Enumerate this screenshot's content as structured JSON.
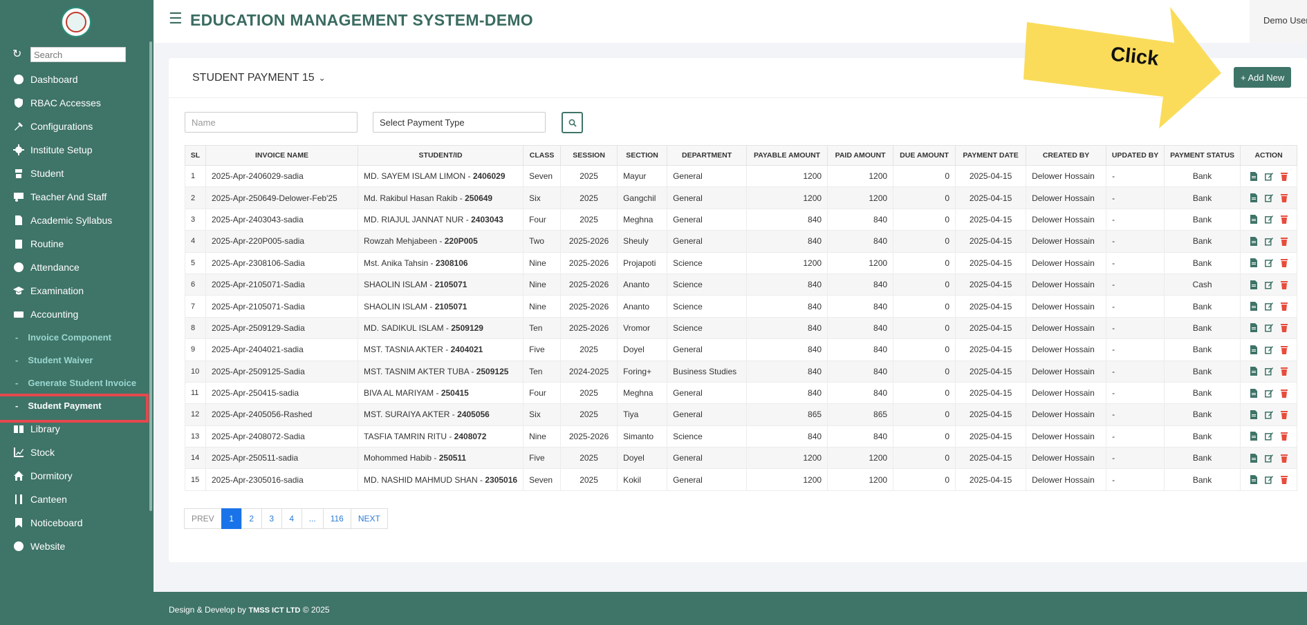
{
  "sidebar": {
    "search_placeholder": "Search",
    "items": [
      {
        "label": "Dashboard",
        "icon": "dashboard-icon"
      },
      {
        "label": "RBAC Accesses",
        "icon": "shield-icon"
      },
      {
        "label": "Configurations",
        "icon": "tools-icon"
      },
      {
        "label": "Institute Setup",
        "icon": "gear-icon"
      },
      {
        "label": "Student",
        "icon": "student-icon"
      },
      {
        "label": "Teacher And Staff",
        "icon": "teacher-icon"
      },
      {
        "label": "Academic Syllabus",
        "icon": "document-icon"
      },
      {
        "label": "Routine",
        "icon": "clipboard-icon"
      },
      {
        "label": "Attendance",
        "icon": "check-circle-icon"
      },
      {
        "label": "Examination",
        "icon": "graduation-cap-icon"
      },
      {
        "label": "Accounting",
        "icon": "money-icon"
      }
    ],
    "subitems": [
      {
        "label": "Invoice Component"
      },
      {
        "label": "Student Waiver"
      },
      {
        "label": "Generate Student Invoice"
      },
      {
        "label": "Student Payment"
      }
    ],
    "items2": [
      {
        "label": "Library",
        "icon": "book-icon"
      },
      {
        "label": "Stock",
        "icon": "chart-icon"
      },
      {
        "label": "Dormitory",
        "icon": "home-icon"
      },
      {
        "label": "Canteen",
        "icon": "utensils-icon"
      },
      {
        "label": "Noticeboard",
        "icon": "bookmark-icon"
      },
      {
        "label": "Website",
        "icon": "globe-icon"
      }
    ]
  },
  "header": {
    "title": "EDUCATION MANAGEMENT SYSTEM-DEMO",
    "user": "Demo User"
  },
  "card": {
    "title": "STUDENT PAYMENT 15",
    "add_label": "+ Add New"
  },
  "callout": {
    "text": "Click"
  },
  "filters": {
    "name_placeholder": "Name",
    "payment_type": "Select Payment Type"
  },
  "table": {
    "headers": [
      "SL",
      "INVOICE NAME",
      "STUDENT/ID",
      "CLASS",
      "SESSION",
      "SECTION",
      "DEPARTMENT",
      "PAYABLE AMOUNT",
      "PAID AMOUNT",
      "DUE AMOUNT",
      "PAYMENT DATE",
      "CREATED BY",
      "UPDATED BY",
      "PAYMENT STATUS",
      "ACTION"
    ],
    "rows": [
      {
        "sl": "1",
        "invoice": "2025-Apr-2406029-sadia",
        "student": "MD. SAYEM ISLAM LIMON - ",
        "sid": "2406029",
        "cls": "Seven",
        "session": "2025",
        "section": "Mayur",
        "dept": "General",
        "payable": "1200",
        "paid": "1200",
        "due": "0",
        "date": "2025-04-15",
        "created": "Delower Hossain",
        "updated": "-",
        "status": "Bank"
      },
      {
        "sl": "2",
        "invoice": "2025-Apr-250649-Delower-Feb'25",
        "student": "Md. Rakibul Hasan Rakib - ",
        "sid": "250649",
        "cls": "Six",
        "session": "2025",
        "section": "Gangchil",
        "dept": "General",
        "payable": "1200",
        "paid": "1200",
        "due": "0",
        "date": "2025-04-15",
        "created": "Delower Hossain",
        "updated": "-",
        "status": "Bank"
      },
      {
        "sl": "3",
        "invoice": "2025-Apr-2403043-sadia",
        "student": "MD. RIAJUL JANNAT NUR - ",
        "sid": "2403043",
        "cls": "Four",
        "session": "2025",
        "section": "Meghna",
        "dept": "General",
        "payable": "840",
        "paid": "840",
        "due": "0",
        "date": "2025-04-15",
        "created": "Delower Hossain",
        "updated": "-",
        "status": "Bank"
      },
      {
        "sl": "4",
        "invoice": "2025-Apr-220P005-sadia",
        "student": "Rowzah Mehjabeen - ",
        "sid": "220P005",
        "cls": "Two",
        "session": "2025-2026",
        "section": "Sheuly",
        "dept": "General",
        "payable": "840",
        "paid": "840",
        "due": "0",
        "date": "2025-04-15",
        "created": "Delower Hossain",
        "updated": "-",
        "status": "Bank"
      },
      {
        "sl": "5",
        "invoice": "2025-Apr-2308106-Sadia",
        "student": "Mst. Anika Tahsin - ",
        "sid": "2308106",
        "cls": "Nine",
        "session": "2025-2026",
        "section": "Projapoti",
        "dept": "Science",
        "payable": "1200",
        "paid": "1200",
        "due": "0",
        "date": "2025-04-15",
        "created": "Delower Hossain",
        "updated": "-",
        "status": "Bank"
      },
      {
        "sl": "6",
        "invoice": "2025-Apr-2105071-Sadia",
        "student": "SHAOLIN ISLAM - ",
        "sid": "2105071",
        "cls": "Nine",
        "session": "2025-2026",
        "section": "Ananto",
        "dept": "Science",
        "payable": "840",
        "paid": "840",
        "due": "0",
        "date": "2025-04-15",
        "created": "Delower Hossain",
        "updated": "-",
        "status": "Cash"
      },
      {
        "sl": "7",
        "invoice": "2025-Apr-2105071-Sadia",
        "student": "SHAOLIN ISLAM - ",
        "sid": "2105071",
        "cls": "Nine",
        "session": "2025-2026",
        "section": "Ananto",
        "dept": "Science",
        "payable": "840",
        "paid": "840",
        "due": "0",
        "date": "2025-04-15",
        "created": "Delower Hossain",
        "updated": "-",
        "status": "Bank"
      },
      {
        "sl": "8",
        "invoice": "2025-Apr-2509129-Sadia",
        "student": "MD. SADIKUL ISLAM - ",
        "sid": "2509129",
        "cls": "Ten",
        "session": "2025-2026",
        "section": "Vromor",
        "dept": "Science",
        "payable": "840",
        "paid": "840",
        "due": "0",
        "date": "2025-04-15",
        "created": "Delower Hossain",
        "updated": "-",
        "status": "Bank"
      },
      {
        "sl": "9",
        "invoice": "2025-Apr-2404021-sadia",
        "student": "MST. TASNIA AKTER - ",
        "sid": "2404021",
        "cls": "Five",
        "session": "2025",
        "section": "Doyel",
        "dept": "General",
        "payable": "840",
        "paid": "840",
        "due": "0",
        "date": "2025-04-15",
        "created": "Delower Hossain",
        "updated": "-",
        "status": "Bank"
      },
      {
        "sl": "10",
        "invoice": "2025-Apr-2509125-Sadia",
        "student": "MST. TASNIM AKTER TUBA - ",
        "sid": "2509125",
        "cls": "Ten",
        "session": "2024-2025",
        "section": "Foring+",
        "dept": "Business Studies",
        "payable": "840",
        "paid": "840",
        "due": "0",
        "date": "2025-04-15",
        "created": "Delower Hossain",
        "updated": "-",
        "status": "Bank"
      },
      {
        "sl": "11",
        "invoice": "2025-Apr-250415-sadia",
        "student": "BIVA AL MARIYAM - ",
        "sid": "250415",
        "cls": "Four",
        "session": "2025",
        "section": "Meghna",
        "dept": "General",
        "payable": "840",
        "paid": "840",
        "due": "0",
        "date": "2025-04-15",
        "created": "Delower Hossain",
        "updated": "-",
        "status": "Bank"
      },
      {
        "sl": "12",
        "invoice": "2025-Apr-2405056-Rashed",
        "student": "MST. SURAIYA AKTER - ",
        "sid": "2405056",
        "cls": "Six",
        "session": "2025",
        "section": "Tiya",
        "dept": "General",
        "payable": "865",
        "paid": "865",
        "due": "0",
        "date": "2025-04-15",
        "created": "Delower Hossain",
        "updated": "-",
        "status": "Bank"
      },
      {
        "sl": "13",
        "invoice": "2025-Apr-2408072-Sadia",
        "student": "TASFIA TAMRIN RITU - ",
        "sid": "2408072",
        "cls": "Nine",
        "session": "2025-2026",
        "section": "Simanto",
        "dept": "Science",
        "payable": "840",
        "paid": "840",
        "due": "0",
        "date": "2025-04-15",
        "created": "Delower Hossain",
        "updated": "-",
        "status": "Bank"
      },
      {
        "sl": "14",
        "invoice": "2025-Apr-250511-sadia",
        "student": "Mohommed Habib - ",
        "sid": "250511",
        "cls": "Five",
        "session": "2025",
        "section": "Doyel",
        "dept": "General",
        "payable": "1200",
        "paid": "1200",
        "due": "0",
        "date": "2025-04-15",
        "created": "Delower Hossain",
        "updated": "-",
        "status": "Bank"
      },
      {
        "sl": "15",
        "invoice": "2025-Apr-2305016-sadia",
        "student": "MD. NASHID MAHMUD SHAN - ",
        "sid": "2305016",
        "cls": "Seven",
        "session": "2025",
        "section": "Kokil",
        "dept": "General",
        "payable": "1200",
        "paid": "1200",
        "due": "0",
        "date": "2025-04-15",
        "created": "Delower Hossain",
        "updated": "-",
        "status": "Bank"
      }
    ]
  },
  "pagination": [
    "PREV",
    "1",
    "2",
    "3",
    "4",
    "...",
    "116",
    "NEXT"
  ],
  "footer": {
    "prefix": "Design & Develop by ",
    "brand": "TMSS ICT LTD",
    "suffix": " © 2025"
  }
}
